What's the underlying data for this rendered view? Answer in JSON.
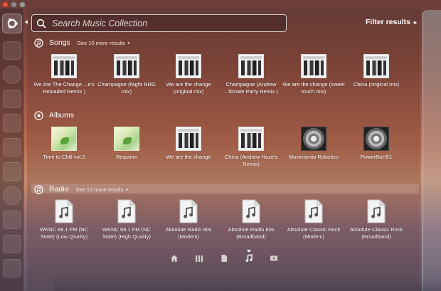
{
  "search": {
    "placeholder": "Search Music Collection"
  },
  "filter": {
    "label": "Filter results",
    "chevron": "▸"
  },
  "sections": {
    "songs": {
      "title": "Songs",
      "more": "See 10 more results",
      "items": [
        {
          "label": "We Are The Change ...e's Reloaded Remix )",
          "art": "single"
        },
        {
          "label": "Champagne (Night NRG mix)",
          "art": "single"
        },
        {
          "label": "We are the change (original mix)",
          "art": "single"
        },
        {
          "label": "Champagne (Andrew ...ltimate Party Remix )",
          "art": "single"
        },
        {
          "label": "We are the change (sweet touch mix)",
          "art": "single"
        },
        {
          "label": "China (original mix)",
          "art": "single"
        }
      ]
    },
    "albums": {
      "title": "Albums",
      "items": [
        {
          "label": "Time to Chill vol.2",
          "art": "chill"
        },
        {
          "label": "Requiem",
          "art": "chill"
        },
        {
          "label": "We are the change",
          "art": "single"
        },
        {
          "label": "China (Andrew Haze's Remix)",
          "art": "single"
        },
        {
          "label": "Movimiento Robotico",
          "art": "vinyl"
        },
        {
          "label": "PowerBot-B1",
          "art": "vinyl"
        }
      ]
    },
    "radio": {
      "title": "Radio",
      "more": "See 13 more results",
      "items": [
        {
          "label": "WKNC 88.1 FM (NC State) (Low Quality)",
          "art": "audio-file-icon"
        },
        {
          "label": "WKNC 88.1 FM (NC State) (High Quality)",
          "art": "audio-file-icon"
        },
        {
          "label": "Absolute Radio 80s (Modem)",
          "art": "audio-file-icon"
        },
        {
          "label": "Absolute Radio 80s (Broadband)",
          "art": "audio-file-icon"
        },
        {
          "label": "Absolute Classic Rock (Modem)",
          "art": "audio-file-icon"
        },
        {
          "label": "Absolute Classic Rock (Broadband)",
          "art": "audio-file-icon"
        }
      ]
    }
  },
  "lenses": [
    "home-icon",
    "applications-icon",
    "files-icon",
    "music-icon",
    "video-icon"
  ],
  "active_lens": "music-icon",
  "colors": {
    "text": "#ffffff",
    "close": "#e0543a"
  }
}
